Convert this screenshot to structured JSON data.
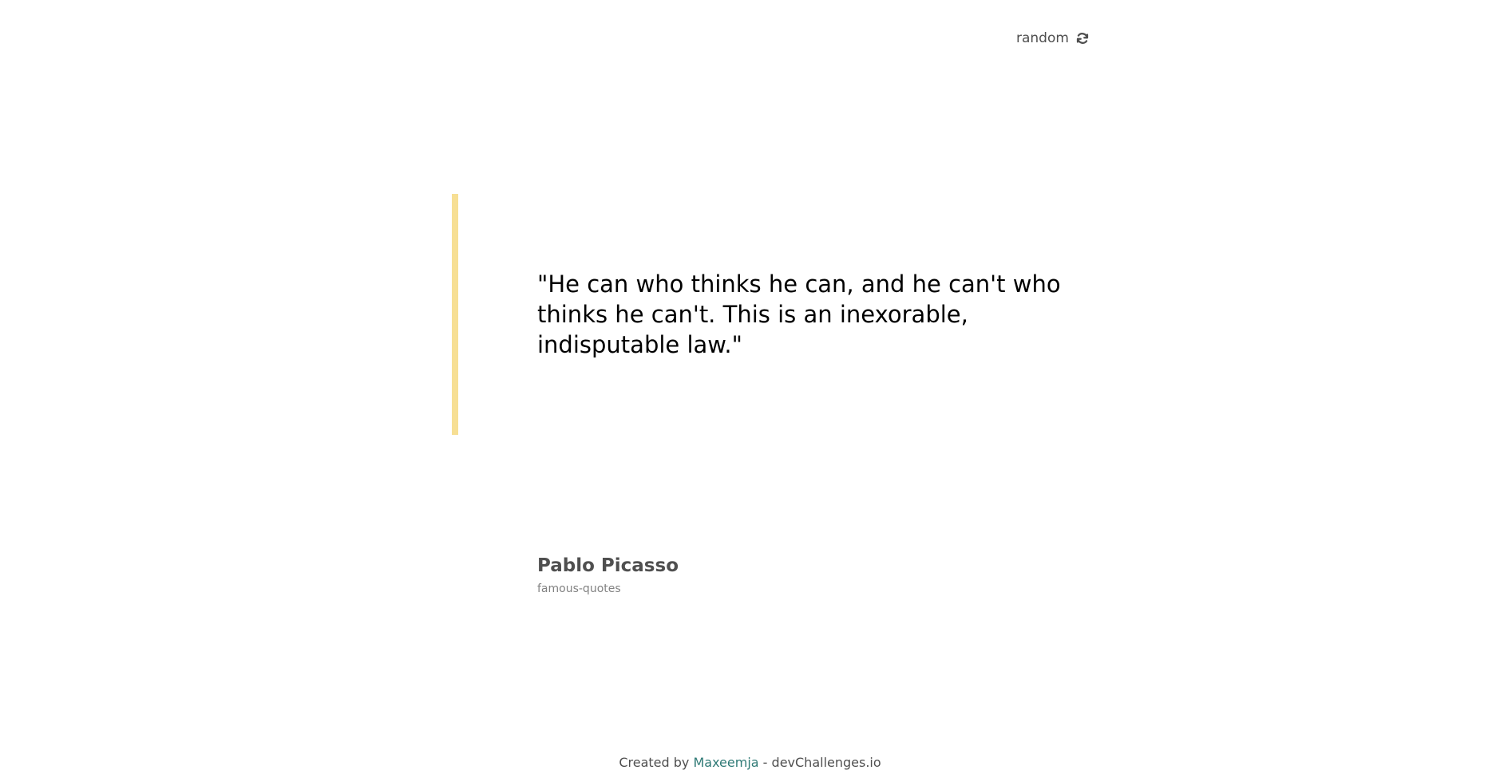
{
  "header": {
    "random_label": "random",
    "random_icon": "refresh-icon"
  },
  "quote": {
    "text": "\"He can who thinks he can, and he can't who thinks he can't. This is an inexorable, indisputable law.\"",
    "accent_color": "#f7df94"
  },
  "author": {
    "name": "Pablo Picasso",
    "genre": "famous-quotes"
  },
  "footer": {
    "prefix": "Created by",
    "author_link": "Maxeemja",
    "separator": "-",
    "site": "devChallenges.io",
    "link_color": "#2f7a76"
  }
}
